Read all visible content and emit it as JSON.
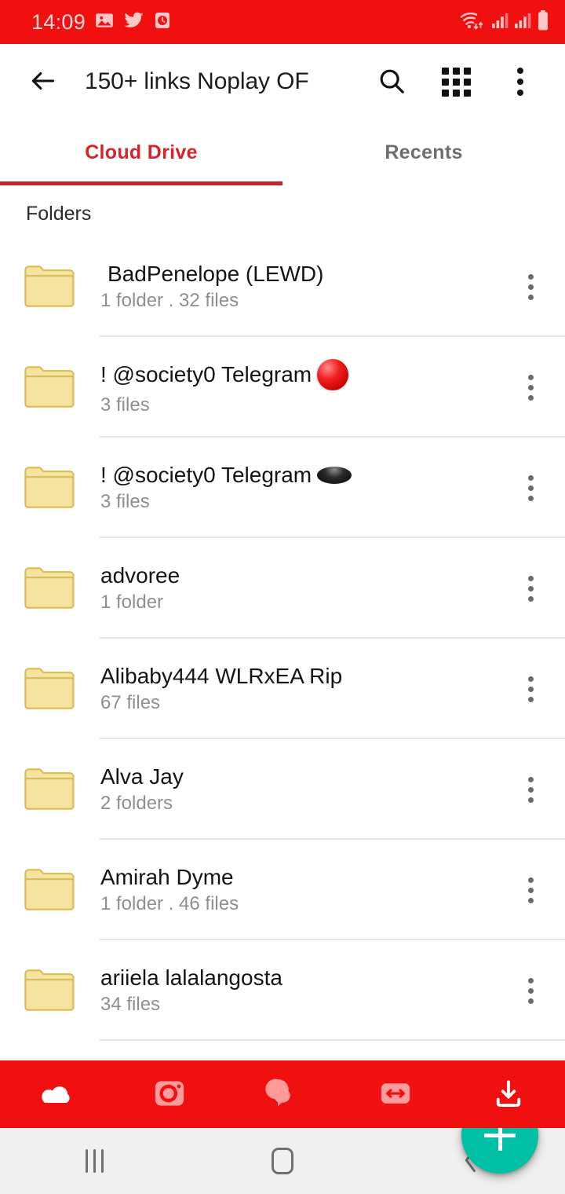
{
  "status_bar": {
    "time": "14:09",
    "left_icons": [
      "photo-icon",
      "twitter-icon",
      "alarm-icon"
    ],
    "right_icons": [
      "wifi-icon",
      "signal-icon",
      "signal-icon",
      "battery-icon"
    ],
    "background_color": "#f01010"
  },
  "toolbar": {
    "back_label": "back-arrow",
    "title": "150+ links Noplay OF",
    "search_label": "search",
    "grid_label": "grid view",
    "overflow_label": "more options"
  },
  "tabs": {
    "items": [
      {
        "label": "Cloud Drive",
        "active": true
      },
      {
        "label": "Recents",
        "active": false
      }
    ],
    "active_color": "#d8232a",
    "inactive_color": "#6e6e6e"
  },
  "section": {
    "folders_header": "Folders"
  },
  "folders": [
    {
      "name": "BadPenelope (LEWD)",
      "info": "1 folder . 32 files",
      "emoji": "",
      "indented": true
    },
    {
      "name": "! @society0 Telegram",
      "info": "3 files",
      "emoji": "red-sphere",
      "indented": false
    },
    {
      "name": "! @society0 Telegram",
      "info": "3 files",
      "emoji": "black-ellipse",
      "indented": false
    },
    {
      "name": "advoree",
      "info": "1 folder",
      "emoji": "",
      "indented": false
    },
    {
      "name": "Alibaby444 WLRxEA Rip",
      "info": "67 files",
      "emoji": "",
      "indented": false
    },
    {
      "name": "Alva Jay",
      "info": "2 folders",
      "emoji": "",
      "indented": false
    },
    {
      "name": "Amirah Dyme",
      "info": "1 folder . 46 files",
      "emoji": "",
      "indented": false
    },
    {
      "name": "ariiela lalalangosta",
      "info": "34 files",
      "emoji": "",
      "indented": false
    }
  ],
  "fab": {
    "label": "+",
    "color": "#00bfa5"
  },
  "bottom_nav": {
    "items": [
      {
        "name": "cloud-drive",
        "icon": "cloud-icon",
        "active": true
      },
      {
        "name": "camera-uploads",
        "icon": "camera-icon",
        "active": false
      },
      {
        "name": "chat",
        "icon": "chat-bubbles-icon",
        "active": false
      },
      {
        "name": "transfers",
        "icon": "transfers-icon",
        "active": false
      },
      {
        "name": "offline",
        "icon": "download-icon",
        "active": false
      }
    ],
    "background_color": "#f01010"
  },
  "android_nav": {
    "items": [
      "recents-button",
      "home-button",
      "back-button"
    ]
  }
}
